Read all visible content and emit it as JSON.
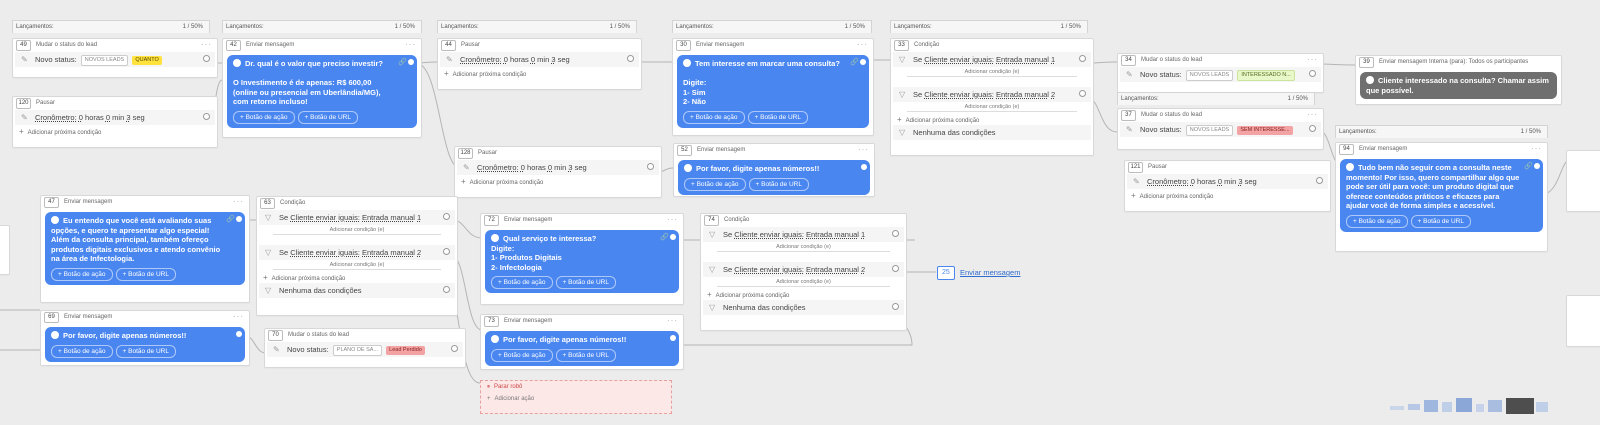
{
  "common": {
    "lancamentos_label": "Lançamentos:",
    "lancamentos_count": "1 / 50%",
    "add_condition": "Adicionar próxima condição",
    "add_condition_sub": "Adicionar condição (e)",
    "btn_action": "+ Botão de ação",
    "btn_url": "+ Botão de URL",
    "none_conditions": "Nenhuma das condições",
    "new_status": "Novo status:",
    "timer": "Cronômetro:",
    "timer_value": {
      "h": "0",
      "h_unit": "horas",
      "m": "0",
      "m_unit": "min",
      "s": "3",
      "s_unit": "seg"
    }
  },
  "nodes": {
    "n49": {
      "num": "49",
      "type": "Mudar o status do lead",
      "status_group": "NOVOS LEADS",
      "status_value": "QUANTO"
    },
    "n120": {
      "num": "120",
      "type": "Pausar"
    },
    "n42": {
      "num": "42",
      "type": "Enviar mensagem",
      "text": "Dr. qual é o valor que preciso investir?\n\nO Investimento é de apenas: R$ 600,00 (online ou presencial em Uberlândia/MG), com retorno incluso!"
    },
    "n44": {
      "num": "44",
      "type": "Pausar"
    },
    "n30": {
      "num": "30",
      "type": "Enviar mensagem",
      "text": "Tem interesse em marcar uma consulta?\n\nDigite:\n1- Sim\n2- Não"
    },
    "n128": {
      "num": "128",
      "type": "Pausar"
    },
    "n52": {
      "num": "52",
      "type": "Enviar mensagem",
      "text": "Por favor, digite apenas números!!"
    },
    "n33": {
      "num": "33",
      "type": "Condição",
      "cond1": {
        "prefix": "Se",
        "field": "Cliente enviar iguais:",
        "value": "Entrada manual",
        "n": "1"
      },
      "cond2": {
        "prefix": "Se",
        "field": "Cliente enviar iguais:",
        "value": "Entrada manual",
        "n": "2"
      }
    },
    "n34": {
      "num": "34",
      "type": "Mudar o status do lead",
      "status_group": "NOVOS LEADS",
      "status_value": "INTERESSADO N..."
    },
    "n39": {
      "num": "39",
      "type": "Enviar mensagem Interna (para):",
      "target": "Todos os participantes",
      "text": "Cliente interessado na consulta? Chamar assim que possível."
    },
    "n37": {
      "num": "37",
      "type": "Mudar o status do lead",
      "status_group": "NOVOS LEADS",
      "status_value": "SEM INTERESSE..."
    },
    "n121": {
      "num": "121",
      "type": "Pausar"
    },
    "n94": {
      "num": "94",
      "type": "Enviar mensagem",
      "text": "Tudo bem não seguir com a consulta neste momento! Por isso, quero compartilhar algo que pode ser útil para você: um produto digital que oferece conteúdos práticos e eficazes para ajudar você de forma simples e acessível."
    },
    "n47": {
      "num": "47",
      "type": "Enviar mensagem",
      "text": "Eu entendo que você está avaliando suas opções, e quero te apresentar algo especial! Além da consulta principal, também ofereço produtos digitais exclusivos e atendo convênio na área de Infectologia."
    },
    "n63": {
      "num": "63",
      "type": "Condição",
      "cond1": {
        "prefix": "Se",
        "field": "Cliente enviar iguais:",
        "value": "Entrada manual",
        "n": "1"
      },
      "cond2": {
        "prefix": "Se",
        "field": "Cliente enviar iguais:",
        "value": "Entrada manual",
        "n": "2"
      }
    },
    "n72": {
      "num": "72",
      "type": "Enviar mensagem",
      "text": "Qual serviço te interessa?\nDigite:\n1- Produtos Digitais\n2- Infectologia"
    },
    "n74": {
      "num": "74",
      "type": "Condição",
      "cond1": {
        "prefix": "Se",
        "field": "Cliente enviar iguais:",
        "value": "Entrada manual",
        "n": "1"
      },
      "cond2": {
        "prefix": "Se",
        "field": "Cliente enviar iguais:",
        "value": "Entrada manual",
        "n": "2"
      }
    },
    "n69": {
      "num": "69",
      "type": "Enviar mensagem",
      "text": "Por favor, digite apenas números!!"
    },
    "n70": {
      "num": "70",
      "type": "Mudar o status do lead",
      "status_group": "PLANO DE SA...",
      "status_value": "Lead Perdido"
    },
    "n73": {
      "num": "73",
      "type": "Enviar mensagem",
      "text": "Por favor, digite apenas números!!"
    }
  },
  "stop": {
    "label": "Parar robô",
    "add_action": "Adicionar ação"
  },
  "goto": {
    "num": "25",
    "label": "Enviar mensagem"
  },
  "colors": {
    "bubble_blue": "#4a86f0",
    "bubble_gray": "#6f6f6f",
    "pill_yellow": "#ffe23b",
    "pill_red": "#f3a3a3",
    "pill_green": "#e9f8c9"
  },
  "icons": {
    "pencil": "pencil-icon",
    "filter": "filter-icon",
    "plus": "plus-icon",
    "whatsapp": "whatsapp-icon",
    "clip": "paperclip-icon",
    "stop": "pause-icon"
  }
}
